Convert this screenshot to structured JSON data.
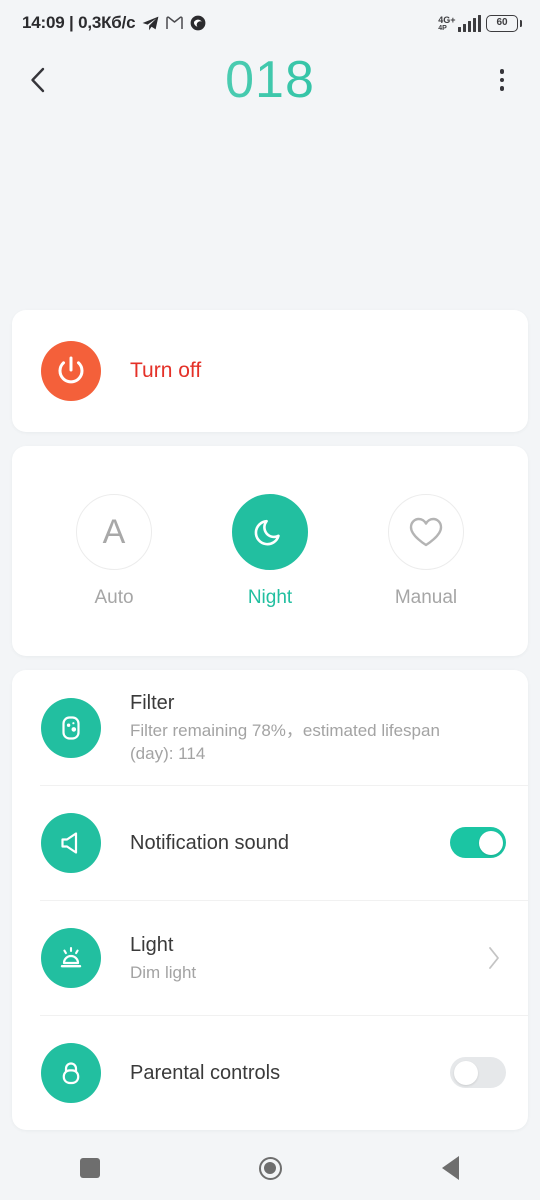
{
  "status_bar": {
    "clock": "14:09 | 0,3Кб/с",
    "icons": [
      "telegram-icon",
      "gmail-icon",
      "app-icon"
    ],
    "network_gen": "4G+",
    "network_sub": "4P",
    "battery_level": "60"
  },
  "app_bar": {
    "back_icon": "chevron-left-icon",
    "title": "018",
    "menu_icon": "more-vertical-icon"
  },
  "power_card": {
    "icon": "power-icon",
    "label": "Turn off",
    "icon_bg": "#F4603A",
    "label_color": "#E43128"
  },
  "modes": {
    "items": [
      {
        "id": "auto",
        "label": "Auto",
        "icon": "letter-a-icon",
        "active": false
      },
      {
        "id": "night",
        "label": "Night",
        "icon": "moon-icon",
        "active": true
      },
      {
        "id": "manual",
        "label": "Manual",
        "icon": "heart-icon",
        "active": false
      }
    ],
    "active_color": "#22BFA0",
    "inactive_color": "#A6A6A6"
  },
  "settings": {
    "rows": [
      {
        "id": "filter",
        "icon": "filter-icon",
        "title": "Filter",
        "subtitle": "Filter remaining 78%，estimated lifespan (day): 114",
        "control": "none"
      },
      {
        "id": "notification-sound",
        "icon": "speaker-icon",
        "title": "Notification sound",
        "subtitle": "",
        "control": "toggle",
        "toggle_on": true
      },
      {
        "id": "light",
        "icon": "brightness-icon",
        "title": "Light",
        "subtitle": "Dim light",
        "control": "chevron",
        "chevron_icon": "chevron-right-icon"
      },
      {
        "id": "parental-controls",
        "icon": "lock-icon",
        "title": "Parental controls",
        "subtitle": "",
        "control": "toggle",
        "toggle_on": false
      }
    ],
    "icon_bg": "#22BFA0",
    "toggle_on_color": "#1BC5A3",
    "toggle_off_color": "#E6E8EA"
  },
  "nav_bar": {
    "recents_icon": "square-icon",
    "home_icon": "circle-icon",
    "back_icon": "triangle-back-icon"
  }
}
